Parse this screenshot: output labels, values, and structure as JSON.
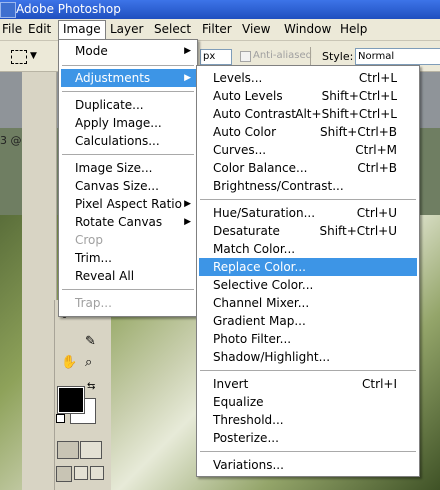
{
  "app": {
    "title": "Adobe Photoshop"
  },
  "menubar": [
    "File",
    "Edit",
    "Image",
    "Layer",
    "Select",
    "Filter",
    "View",
    "Window",
    "Help"
  ],
  "options_bar": {
    "px_value": "px",
    "anti_aliased": "Anti-aliased",
    "style_label": "Style:",
    "style_value": "Normal"
  },
  "document": {
    "tab_text": "3 @"
  },
  "image_menu": {
    "items": [
      {
        "label": "Mode",
        "submenu": true
      },
      {
        "label": "Adjustments",
        "submenu": true,
        "highlighted": true
      },
      {
        "label": "Duplicate..."
      },
      {
        "label": "Apply Image..."
      },
      {
        "label": "Calculations..."
      },
      {
        "label": "Image Size..."
      },
      {
        "label": "Canvas Size..."
      },
      {
        "label": "Pixel Aspect Ratio",
        "submenu": true
      },
      {
        "label": "Rotate Canvas",
        "submenu": true
      },
      {
        "label": "Crop",
        "disabled": true
      },
      {
        "label": "Trim..."
      },
      {
        "label": "Reveal All"
      },
      {
        "label": "Trap...",
        "disabled": true
      }
    ]
  },
  "adjustments_menu": {
    "items": [
      {
        "label": "Levels...",
        "shortcut": "Ctrl+L"
      },
      {
        "label": "Auto Levels",
        "shortcut": "Shift+Ctrl+L"
      },
      {
        "label": "Auto Contrast",
        "shortcut": "Alt+Shift+Ctrl+L"
      },
      {
        "label": "Auto Color",
        "shortcut": "Shift+Ctrl+B"
      },
      {
        "label": "Curves...",
        "shortcut": "Ctrl+M"
      },
      {
        "label": "Color Balance...",
        "shortcut": "Ctrl+B"
      },
      {
        "label": "Brightness/Contrast...",
        "shortcut": ""
      },
      {
        "label": "Hue/Saturation...",
        "shortcut": "Ctrl+U"
      },
      {
        "label": "Desaturate",
        "shortcut": "Shift+Ctrl+U"
      },
      {
        "label": "Match Color...",
        "shortcut": ""
      },
      {
        "label": "Replace Color...",
        "shortcut": "",
        "highlighted": true
      },
      {
        "label": "Selective Color...",
        "shortcut": ""
      },
      {
        "label": "Channel Mixer...",
        "shortcut": ""
      },
      {
        "label": "Gradient Map...",
        "shortcut": ""
      },
      {
        "label": "Photo Filter...",
        "shortcut": ""
      },
      {
        "label": "Shadow/Highlight...",
        "shortcut": ""
      },
      {
        "label": "Invert",
        "shortcut": "Ctrl+I"
      },
      {
        "label": "Equalize",
        "shortcut": ""
      },
      {
        "label": "Threshold...",
        "shortcut": ""
      },
      {
        "label": "Posterize...",
        "shortcut": ""
      },
      {
        "label": "Variations...",
        "shortcut": ""
      }
    ]
  },
  "colors": {
    "highlight": "#3d95e6",
    "titlebar": "#2a5fd0",
    "menubar": "#ece9d8"
  }
}
